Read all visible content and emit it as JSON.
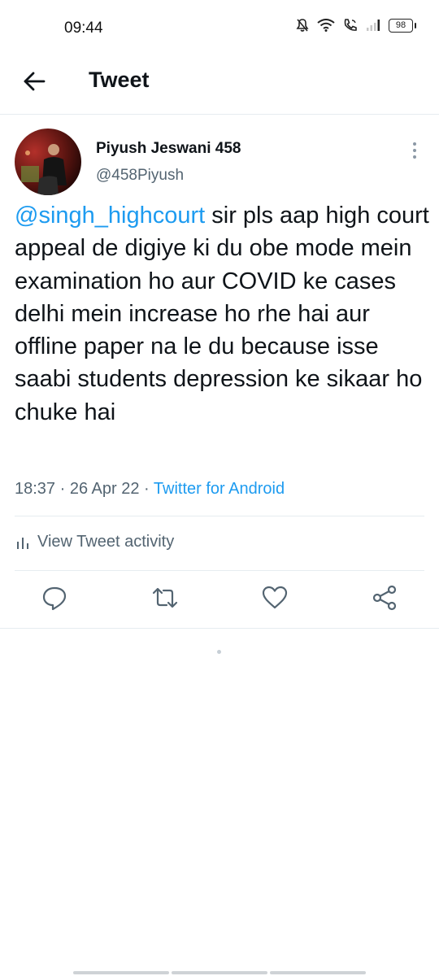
{
  "status_bar": {
    "time": "09:44",
    "battery": "98",
    "icons": [
      "mute-bell-icon",
      "wifi-icon",
      "volte-call-icon",
      "signal-icon",
      "battery-icon"
    ]
  },
  "header": {
    "title": "Tweet"
  },
  "tweet": {
    "author_name": "Piyush Jeswani 458",
    "author_handle": "@458Piyush",
    "mention": "@singh_highcourt",
    "text": " sir pls aap high court appeal de digiye ki du obe mode mein examination ho aur COVID ke cases delhi mein increase ho rhe hai aur offline paper na le du because isse saabi students depression ke sikaar ho chuke hai",
    "time": "18:37",
    "date": "26 Apr 22",
    "separator": "·",
    "source": "Twitter for Android"
  },
  "activity": {
    "label": "View Tweet activity"
  },
  "actions": [
    "reply-icon",
    "retweet-icon",
    "like-icon",
    "share-icon"
  ],
  "colors": {
    "accent": "#1d9bf0",
    "text": "#0f1419",
    "secondary": "#536471",
    "divider": "#e6ecf0"
  }
}
